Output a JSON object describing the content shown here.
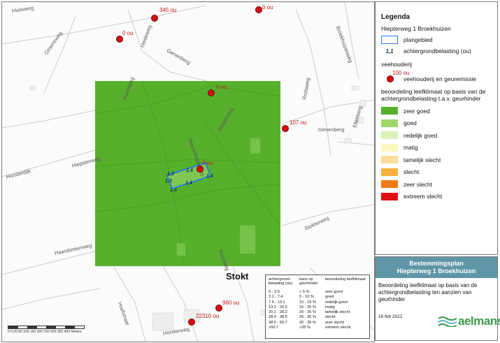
{
  "map": {
    "place_label": "Stokt",
    "roads": [
      "Huiswerg",
      "Groeneweg",
      "Heideweg",
      "Genenberg",
      "Hoofdweg",
      "Hofstraat",
      "Hiepterweg",
      "Hiepsterweg",
      "Hiepselheideweg",
      "Haasdonkerweg",
      "Stokterweg",
      "Roosweg",
      "Rodaweg",
      "Genenberg",
      "Horsterdijk",
      "Broekhuizenweg",
      "Ellenberg",
      "Horsterweg",
      "Hoefstraat",
      "Heideweg"
    ],
    "farms": [
      {
        "label": "345 ou"
      },
      {
        "label": "0 ou"
      },
      {
        "label": "0 ou"
      },
      {
        "label": "0 ou"
      },
      {
        "label": "107 ou"
      },
      {
        "label": "0 ou"
      },
      {
        "label": "960 ou"
      },
      {
        "label": "22310 ou"
      }
    ],
    "background_labels": [
      "1,3",
      "1,3",
      "1,4",
      "1,4",
      "1,4",
      "1,4"
    ],
    "scale": {
      "ticks": "0 0,25 50 100 150 200 250 300 350 400",
      "unit": "Meters"
    }
  },
  "classification": {
    "headers": [
      "achtergrond-belasting (ou)",
      "kans op geurhinder",
      "beoordeling leefklimaat"
    ],
    "rows": [
      [
        "0 - 3.0",
        "< 5 %",
        "zeer goed"
      ],
      [
        "3.1 - 7.4",
        "5 - 10 %",
        "goed"
      ],
      [
        "7.5 - 13.1",
        "10 - 15 %",
        "redelijk goed"
      ],
      [
        "13.2 - 20.0",
        "15 - 20 %",
        "matig"
      ],
      [
        "20.1 - 28.3",
        "20 - 25 %",
        "tamelijk slecht"
      ],
      [
        "28.4 - 38.5",
        "25 - 30 %",
        "slecht"
      ],
      [
        "38.6 - 50.7",
        "30 - 35 %",
        "zeer slecht"
      ],
      [
        ">50.7",
        ">35 %",
        "extreem slecht"
      ]
    ]
  },
  "legend": {
    "title": "Legenda",
    "project": "Hiepterweg 1 Broekhuizen",
    "plangebied": "plangebied",
    "bg_symbol": "1,1",
    "bg_label": "achtergrondbelasting (ou)",
    "veehouderij_heading": "veehouderij",
    "veehouderij_value": "100 ou",
    "veehouderij_label": "veehouderij en geuremissie",
    "assessment_heading": "beoordeling leefklimaat op basis van de achtergrondbelasting t.a.v. geurhinder",
    "classes": [
      {
        "label": "zeer goed",
        "color": "#56b02c"
      },
      {
        "label": "goed",
        "color": "#9ed86a"
      },
      {
        "label": "redelijk goed",
        "color": "#d8f2b8"
      },
      {
        "label": "matig",
        "color": "#fbf6bf"
      },
      {
        "label": "tamelijk slecht",
        "color": "#fbdc9a"
      },
      {
        "label": "slecht",
        "color": "#f5b13a"
      },
      {
        "label": "zeer slecht",
        "color": "#f07a14"
      },
      {
        "label": "extreem slecht",
        "color": "#e01010"
      }
    ]
  },
  "title_block": {
    "line1": "Bestemmingsplan",
    "line2": "Hiepterweg 1 Broekhuizen",
    "subject": "Beoordeling leefklimaat op basis van de achtergrondbelasting ten aanzien van geurhinder",
    "date": "16 feb 2022",
    "logo": "aelmans"
  }
}
